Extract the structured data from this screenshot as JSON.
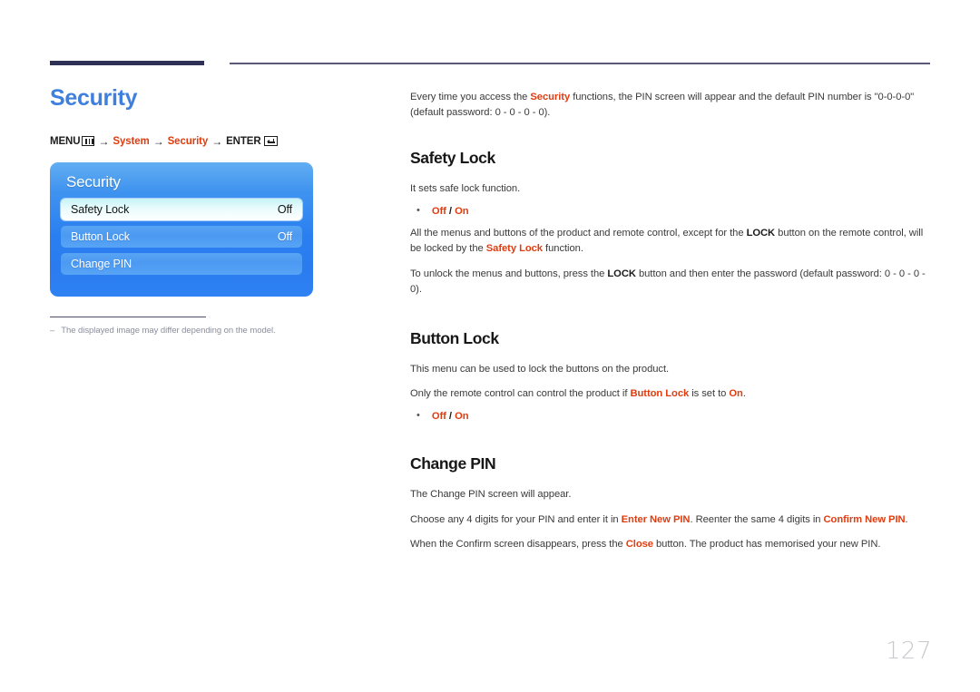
{
  "page": {
    "number": "127"
  },
  "left": {
    "title": "Security",
    "breadcrumb": {
      "menu_label": "MENU",
      "menu_icon": "menu-grid-icon",
      "arrow": "→",
      "item1": "System",
      "item2": "Security",
      "enter_label": "ENTER",
      "enter_icon": "enter-return-icon"
    },
    "osd": {
      "title": "Security",
      "rows": [
        {
          "label": "Safety Lock",
          "value": "Off",
          "selected": true
        },
        {
          "label": "Button Lock",
          "value": "Off",
          "selected": false
        },
        {
          "label": "Change PIN",
          "value": "",
          "selected": false
        }
      ]
    },
    "note": {
      "dash": "–",
      "text": "The displayed image may differ depending on the model."
    }
  },
  "right": {
    "intro": {
      "p1_a": "Every time you access the ",
      "p1_b": "Security",
      "p1_c": " functions, the PIN screen will appear and the default PIN number is \"0-0-0-0\" (default password: 0 - 0 - 0 - 0)."
    },
    "sections": [
      {
        "heading": "Safety Lock",
        "p1": "It sets safe lock function.",
        "bullet_off": "Off",
        "bullet_sep": " / ",
        "bullet_on": "On",
        "p2_a": "All the menus and buttons of the product and remote control, except for the ",
        "p2_b": "LOCK",
        "p2_c": " button on the remote control, will be locked by the ",
        "p2_d": "Safety Lock",
        "p2_e": " function.",
        "p3_a": "To unlock the menus and buttons, press the ",
        "p3_b": "LOCK",
        "p3_c": " button and then enter the password (default password: 0 - 0 - 0 - 0)."
      },
      {
        "heading": "Button Lock",
        "p1": "This menu can be used to lock the buttons on the product.",
        "p2_a": "Only the remote control can control the product if ",
        "p2_b": "Button Lock",
        "p2_c": " is set to ",
        "p2_d": "On",
        "p2_e": ".",
        "bullet_off": "Off",
        "bullet_sep": " / ",
        "bullet_on": "On"
      },
      {
        "heading": "Change PIN",
        "p1": "The Change PIN screen will appear.",
        "p2_a": "Choose any 4 digits for your PIN and enter it in ",
        "p2_b": "Enter New PIN",
        "p2_c": ". Reenter the same 4 digits in ",
        "p2_d": "Confirm New PIN",
        "p2_e": ".",
        "p3_a": "When the Confirm screen disappears, press the ",
        "p3_b": "Close",
        "p3_c": " button. The product has memorised your new PIN."
      }
    ]
  },
  "colors": {
    "accent_red": "#e03c10",
    "title_blue": "#3f7fdd",
    "rule_navy": "#2e3155",
    "body_gray": "#3a3a3a",
    "page_num_gray": "#c9c9ce"
  }
}
